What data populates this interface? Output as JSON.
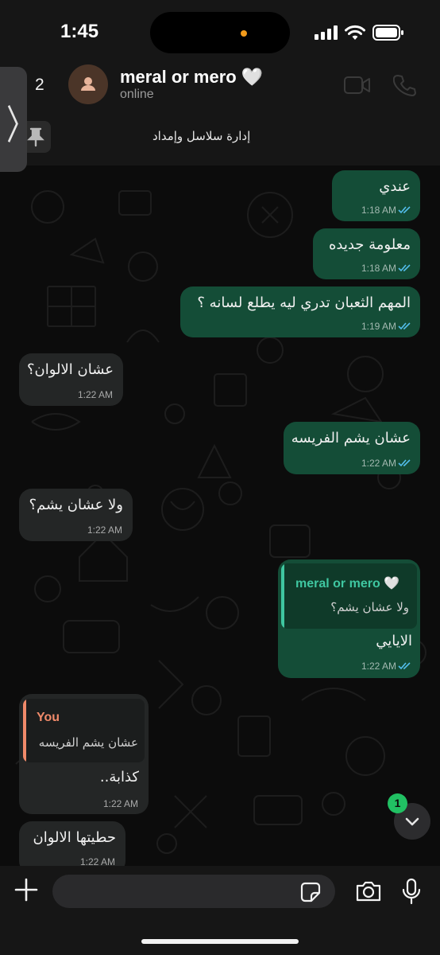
{
  "status_bar": {
    "time": "1:45"
  },
  "header": {
    "back_count": "2",
    "contact_name": "meral or mero 🤍",
    "contact_status": "online",
    "pinned_text": "إدارة سلاسل وإمداد"
  },
  "messages": [
    {
      "direction": "out",
      "text": "عندي",
      "time": "1:18 AM"
    },
    {
      "direction": "out",
      "text": "معلومة جديده",
      "time": "1:18 AM"
    },
    {
      "direction": "out",
      "text": "المهم الثعبان تدري ليه يطلع لسانه ؟",
      "time": "1:19 AM"
    },
    {
      "direction": "in",
      "text": "عشان الالوان؟",
      "time": "1:22 AM"
    },
    {
      "direction": "out",
      "text": "عشان يشم الفريسه",
      "time": "1:22 AM"
    },
    {
      "direction": "in",
      "text": "ولا عشان يشم؟",
      "time": "1:22 AM"
    },
    {
      "direction": "out",
      "text": "الايايي",
      "time": "1:22 AM",
      "reply_to": {
        "name": "meral or mero 🤍",
        "text": "ولا عشان يشم؟"
      }
    },
    {
      "direction": "in",
      "text": "كذابة..",
      "time": "1:22 AM",
      "reply_to": {
        "name": "You",
        "text": "عشان يشم الفريسه"
      }
    },
    {
      "direction": "in",
      "text": "حطيتها الالوان",
      "time": "1:22 AM"
    }
  ],
  "scroll_fab": {
    "unread_count": "1"
  },
  "composer": {
    "placeholder": ""
  },
  "colors": {
    "outgoing_bubble": "#144d37",
    "incoming_bubble": "#242626",
    "read_ticks": "#53bdeb",
    "accent_green": "#21c063",
    "reply_you": "#f08a6a",
    "reply_contact": "#3fc7a1"
  },
  "icons": [
    "side-chevron-icon",
    "person-icon",
    "video-call-icon",
    "phone-call-icon",
    "pin-icon",
    "double-tick-icon",
    "chevron-down-icon",
    "plus-icon",
    "sticker-icon",
    "camera-icon",
    "mic-icon"
  ]
}
